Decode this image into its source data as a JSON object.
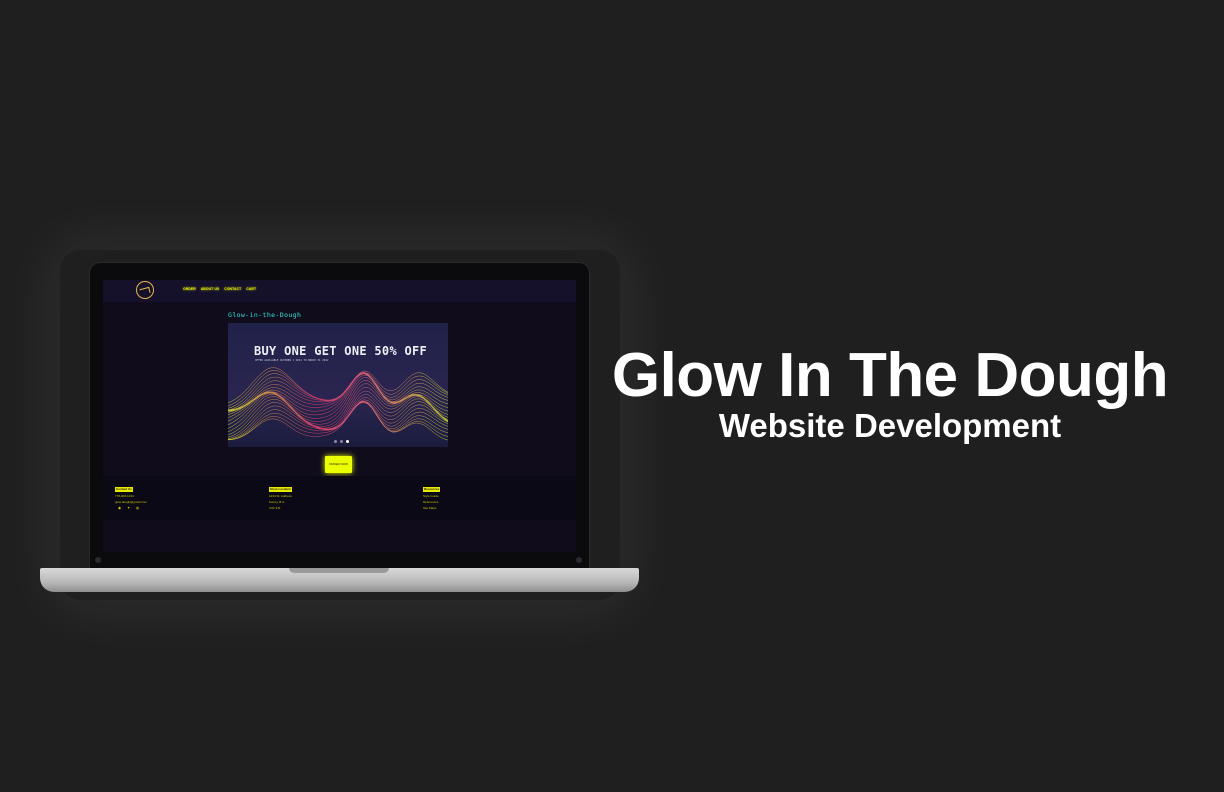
{
  "hero": {
    "title": "Glow In The Dough",
    "subtitle": "Website Development"
  },
  "site": {
    "nav": [
      "ORDER",
      "ABOUT US",
      "CONTACT",
      "CART"
    ],
    "brand_title": "Glow-in-the-Dough",
    "banner": {
      "headline": "BUY ONE GET ONE 50% OFF",
      "subline": "OFFER AVAILABLE OCTOBER 1 2021 TO MARCH 31 2022",
      "slide_count": 3,
      "active_slide": 3
    },
    "order_button": "ORDER NOW",
    "footer": {
      "contact": {
        "heading": "Contact Us",
        "lines": [
          "778-000-1234",
          "glow.dough@gmail.com"
        ]
      },
      "location": {
        "heading": "Store Location",
        "lines": [
          "1234 St. Address",
          "Surrey, B.C.",
          "V3V 3J3"
        ]
      },
      "resources": {
        "heading": "Resources",
        "lines": [
          "Style Guide",
          "References",
          "Site Maps"
        ]
      },
      "social_icons": [
        "instagram-icon",
        "twitter-icon",
        "facebook-icon"
      ]
    },
    "colors": {
      "accent": "#eaff00",
      "title": "#2ee6d6",
      "background": "#100c1c"
    }
  }
}
